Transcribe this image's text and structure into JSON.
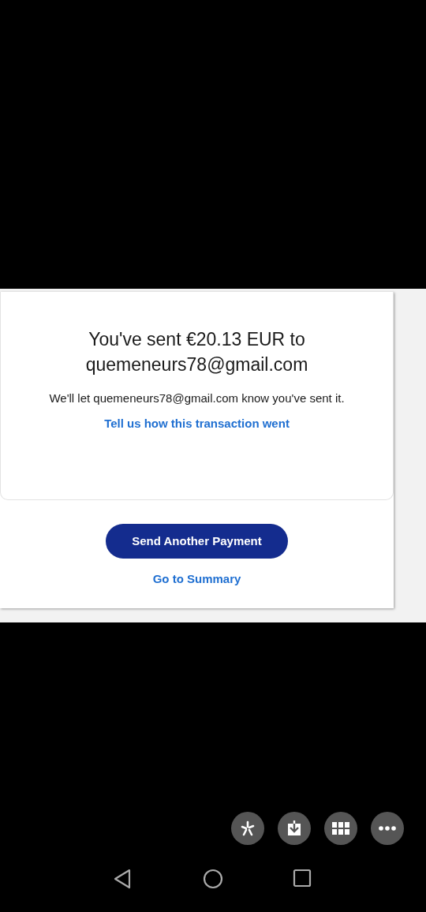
{
  "confirmation": {
    "heading": "You've sent €20.13 EUR to quemeneurs78@gmail.com",
    "message": "We'll let quemeneurs78@gmail.com know you've sent it.",
    "feedback_link": "Tell us how this transaction went"
  },
  "actions": {
    "primary_button": "Send Another Payment",
    "summary_link": "Go to Summary"
  }
}
